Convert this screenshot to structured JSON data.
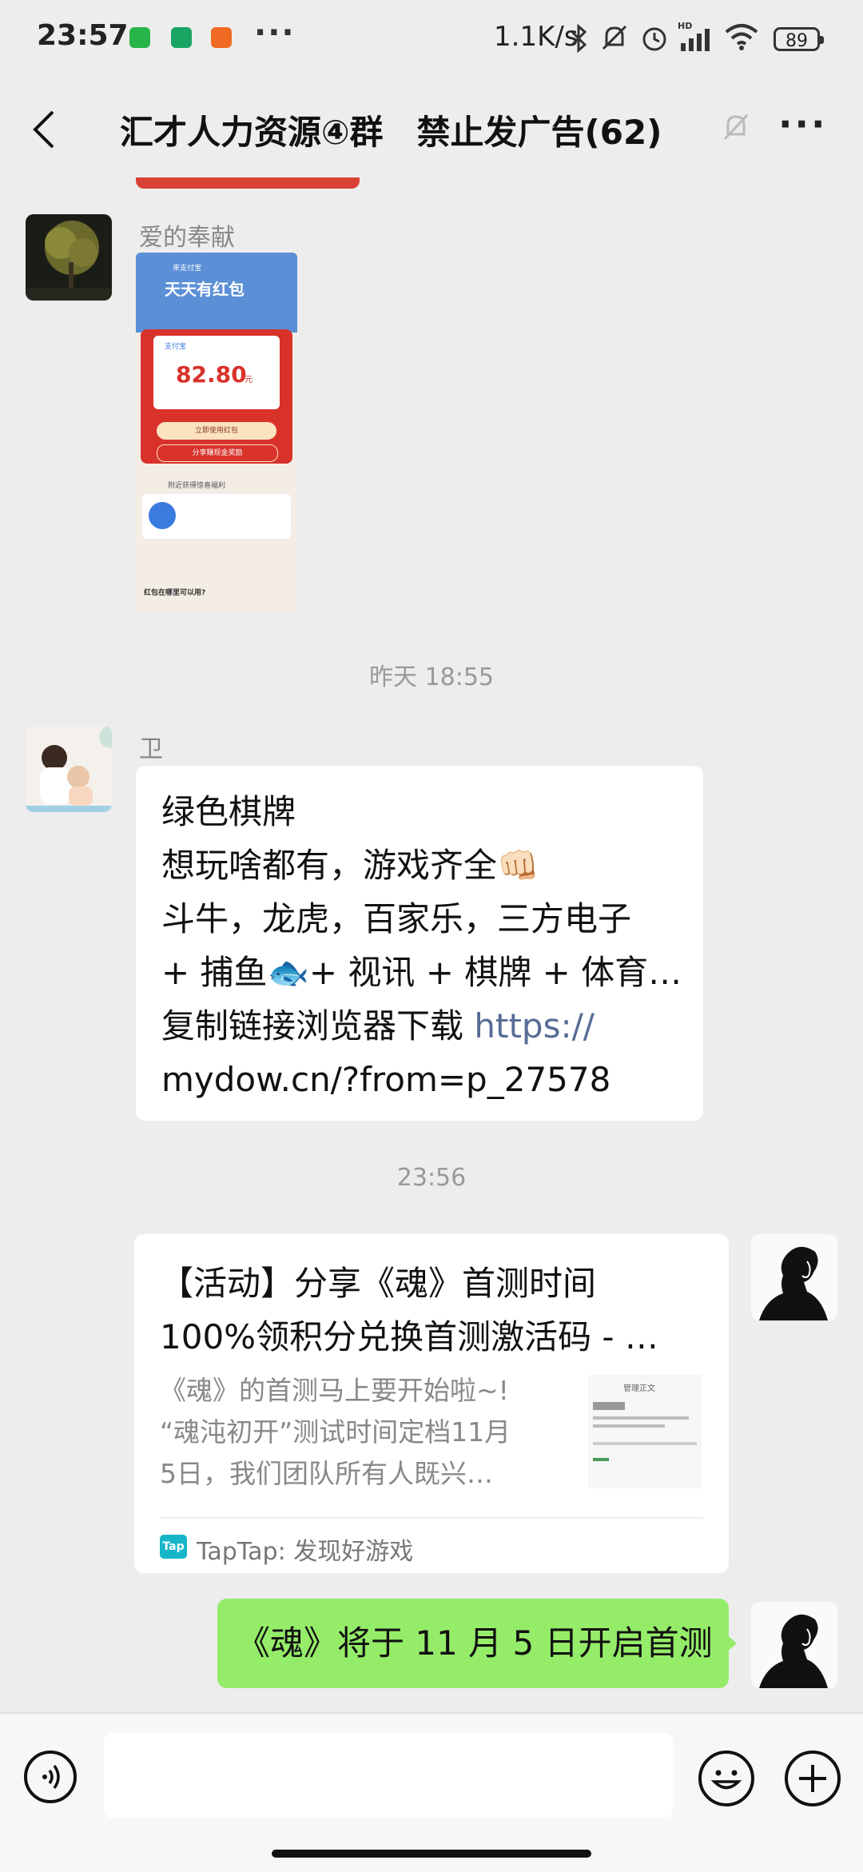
{
  "status_bar": {
    "time": "23:57",
    "more": "···",
    "net_speed": "1.1K/s",
    "battery": "89",
    "notification_icons": [
      "green-app-icon",
      "green-chat-icon",
      "orange-app-icon"
    ]
  },
  "header": {
    "title": "汇才人力资源④群　禁止发广告(62)",
    "back_icon": "chevron-left-icon",
    "mute_icon": "bell-off-icon",
    "more": "···"
  },
  "chat": {
    "msg1": {
      "sender": "爱的奉献",
      "screenshot": {
        "banner": "天天有红包",
        "tag": "来支付宝",
        "app": "支付宝",
        "amount": "82.80",
        "unit": "元",
        "use_button": "立即使用红包",
        "share_button": "分享赚现金奖励",
        "section": "附近获得惊喜福利",
        "faq": "红包在哪里可以用?"
      }
    },
    "timestamp1": "昨天 18:55",
    "msg2": {
      "sender": "卫",
      "line1": "绿色棋牌",
      "line2": "想玩啥都有，游戏齐全👊🏻",
      "line3": "斗牛，龙虎，百家乐，三方电子",
      "line4": "+ 捕鱼🐟+ 视讯 + 棋牌 + 体育…",
      "line5_text": "复制链接浏览器下载 ",
      "line5_link": "https://",
      "line6_link": "mydow.cn/?from=p_27578"
    },
    "timestamp2": "23:56",
    "msg3": {
      "title_line1": "【活动】分享《魂》首测时间",
      "title_line2": "100%领积分兑换首测激活码 - …",
      "desc_line1": "《魂》的首测马上要开始啦~!",
      "desc_line2": "“魂沌初开”测试时间定档11月",
      "desc_line3": "5日，我们团队所有人既兴…",
      "source_badge": "Tap",
      "source": "TapTap: 发现好游戏",
      "thumb_title": "管理正文"
    },
    "msg4": {
      "text": "《魂》将于 11 月 5 日开启首测"
    }
  },
  "input_bar": {
    "voice_icon": "voice-icon",
    "emoji_icon": "emoji-icon",
    "plus_icon": "plus-icon"
  }
}
